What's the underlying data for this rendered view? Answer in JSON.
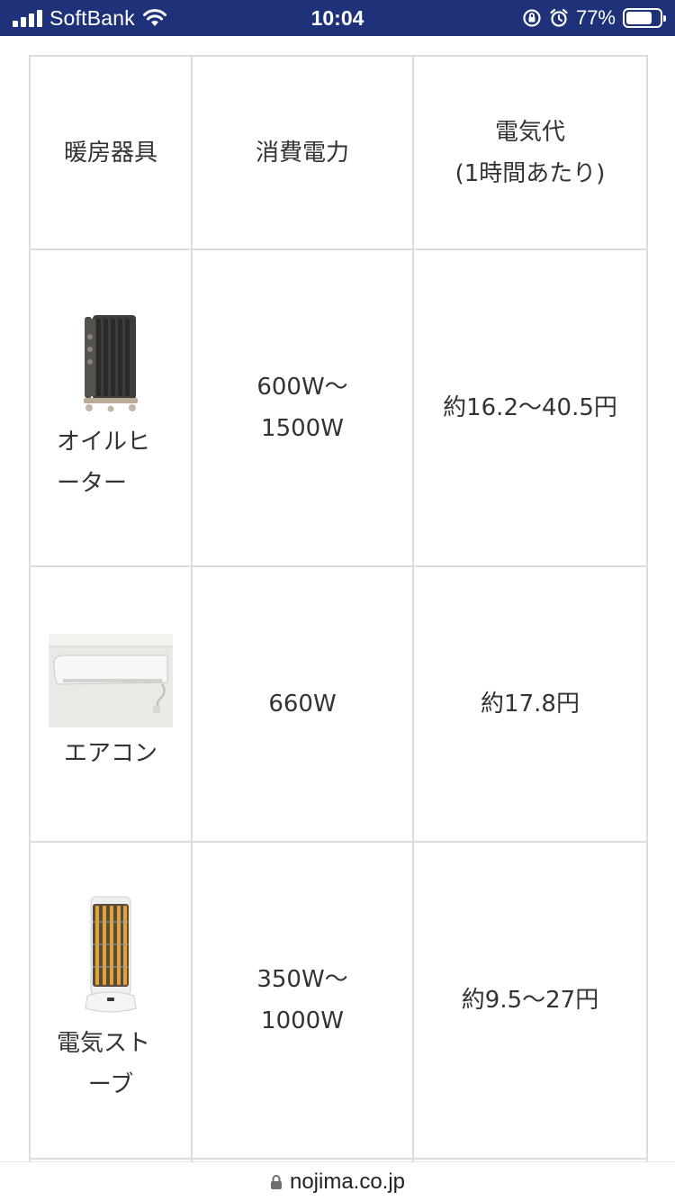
{
  "status_bar": {
    "carrier": "SoftBank",
    "time": "10:04",
    "battery": "77%",
    "battery_level": 0.77,
    "icons": [
      "signal-icon",
      "wifi-icon",
      "orientation-lock-icon",
      "alarm-icon",
      "battery-icon"
    ]
  },
  "table": {
    "headers": [
      "暖房器具",
      "消費電力",
      "電気代",
      "(1時間あたり)"
    ],
    "rows": [
      {
        "name_line1": "オイルヒ",
        "name_line2": "ーター",
        "power_line1": "600W〜",
        "power_line2": "1500W",
        "cost": "約16.2〜40.5円",
        "image": "oil-heater-image"
      },
      {
        "name_line1": "エアコン",
        "power_line1": "660W",
        "cost": "約17.8円",
        "image": "air-conditioner-image"
      },
      {
        "name_line1": "電気スト",
        "name_line2": "ーブ",
        "power_line1": "350W〜",
        "power_line2": "1000W",
        "cost": "約9.5〜27円",
        "image": "electric-stove-image"
      }
    ]
  },
  "url_bar": {
    "domain": "nojima.co.jp",
    "icon": "lock-icon"
  },
  "colors": {
    "status_bar_bg": "#1f3279",
    "table_border": "#dcdcdc",
    "text": "#333333"
  }
}
